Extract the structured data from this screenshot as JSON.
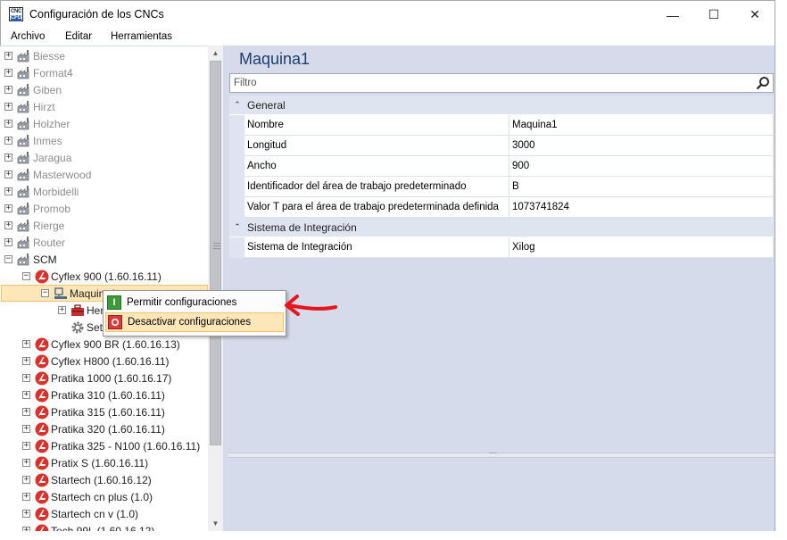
{
  "window": {
    "title": "Configuración de los CNCs",
    "icon_text_top": "CNC",
    "icon_text_bottom": "CFG",
    "controls": {
      "minimize": "—",
      "maximize": "☐",
      "close": "✕"
    }
  },
  "menu": [
    "Archivo",
    "Editar",
    "Herramientas"
  ],
  "tree": {
    "rows": [
      {
        "label": "Biesse",
        "exp": "+",
        "icon": "factory-icon",
        "gray": true
      },
      {
        "label": "Format4",
        "exp": "+",
        "icon": "factory-icon",
        "gray": true
      },
      {
        "label": "Giben",
        "exp": "+",
        "icon": "factory-icon",
        "gray": true
      },
      {
        "label": "Hirzt",
        "exp": "+",
        "icon": "factory-icon",
        "gray": true
      },
      {
        "label": "Holzher",
        "exp": "+",
        "icon": "factory-icon",
        "gray": true
      },
      {
        "label": "Inmes",
        "exp": "+",
        "icon": "factory-icon",
        "gray": true
      },
      {
        "label": "Jaragua",
        "exp": "+",
        "icon": "factory-icon",
        "gray": true
      },
      {
        "label": "Masterwood",
        "exp": "+",
        "icon": "factory-icon",
        "gray": true
      },
      {
        "label": "Morbidelli",
        "exp": "+",
        "icon": "factory-icon",
        "gray": true
      },
      {
        "label": "Promob",
        "exp": "+",
        "icon": "factory-icon",
        "gray": true
      },
      {
        "label": "Rierge",
        "exp": "+",
        "icon": "factory-icon",
        "gray": true
      },
      {
        "label": "Router",
        "exp": "+",
        "icon": "factory-icon",
        "gray": true
      },
      {
        "label": "SCM",
        "exp": "−",
        "icon": "factory-icon",
        "gray": false
      },
      {
        "label": "Cyflex 900 (1.60.16.11)",
        "exp": "−",
        "icon": "cnc-logo-icon",
        "gray": false
      },
      {
        "label": "Maquina1",
        "exp": "−",
        "icon": "machine-icon",
        "gray": false,
        "selected": true
      },
      {
        "label": "Herramientas",
        "exp": "+",
        "icon": "toolbox-icon",
        "gray": false
      },
      {
        "label": "Setup",
        "exp": "",
        "icon": "gear-icon",
        "gray": false
      },
      {
        "label": "Cyflex 900 BR (1.60.16.13)",
        "exp": "+",
        "icon": "cnc-logo-icon",
        "gray": false
      },
      {
        "label": "Cyflex H800 (1.60.16.11)",
        "exp": "+",
        "icon": "cnc-logo-icon",
        "gray": false
      },
      {
        "label": "Pratika 1000 (1.60.16.17)",
        "exp": "+",
        "icon": "cnc-logo-icon",
        "gray": false
      },
      {
        "label": "Pratika 310 (1.60.16.11)",
        "exp": "+",
        "icon": "cnc-logo-icon",
        "gray": false
      },
      {
        "label": "Pratika 315 (1.60.16.11)",
        "exp": "+",
        "icon": "cnc-logo-icon",
        "gray": false
      },
      {
        "label": "Pratika 320 (1.60.16.11)",
        "exp": "+",
        "icon": "cnc-logo-icon",
        "gray": false
      },
      {
        "label": "Pratika 325 - N100 (1.60.16.11)",
        "exp": "+",
        "icon": "cnc-logo-icon",
        "gray": false
      },
      {
        "label": "Pratix S (1.60.16.11)",
        "exp": "+",
        "icon": "cnc-logo-icon",
        "gray": false
      },
      {
        "label": "Startech (1.60.16.12)",
        "exp": "+",
        "icon": "cnc-logo-icon",
        "gray": false
      },
      {
        "label": "Startech cn plus (1.0)",
        "exp": "+",
        "icon": "cnc-logo-icon",
        "gray": false
      },
      {
        "label": "Startech cn v (1.0)",
        "exp": "+",
        "icon": "cnc-logo-icon",
        "gray": false
      },
      {
        "label": "Tech 99L (1.60.16.12)",
        "exp": "+",
        "icon": "cnc-logo-icon",
        "gray": false
      }
    ]
  },
  "details": {
    "title": "Maquina1",
    "filter_placeholder": "Filtro",
    "categories": [
      {
        "name": "General",
        "props": [
          {
            "name": "Nombre",
            "value": "Maquina1"
          },
          {
            "name": "Longitud",
            "value": "3000"
          },
          {
            "name": "Ancho",
            "value": "900"
          },
          {
            "name": "Identificador del área de trabajo predeterminado",
            "value": "B"
          },
          {
            "name": "Valor T para el área de trabajo predeterminada definida",
            "value": "1073741824"
          }
        ]
      },
      {
        "name": "Sistema de Integración",
        "props": [
          {
            "name": "Sistema de Integración",
            "value": "Xilog"
          }
        ]
      }
    ]
  },
  "context_menu": {
    "items": [
      {
        "label": "Permitir configuraciones",
        "icon": "enable-icon",
        "hover": false
      },
      {
        "label": "Desactivar configuraciones",
        "icon": "disable-icon",
        "hover": true
      }
    ]
  },
  "colors": {
    "selection": "#fde7b8",
    "pane_bg": "#d5dbea",
    "annotation_arrow": "#e8141b",
    "cnc_logo": "#d8322a"
  }
}
